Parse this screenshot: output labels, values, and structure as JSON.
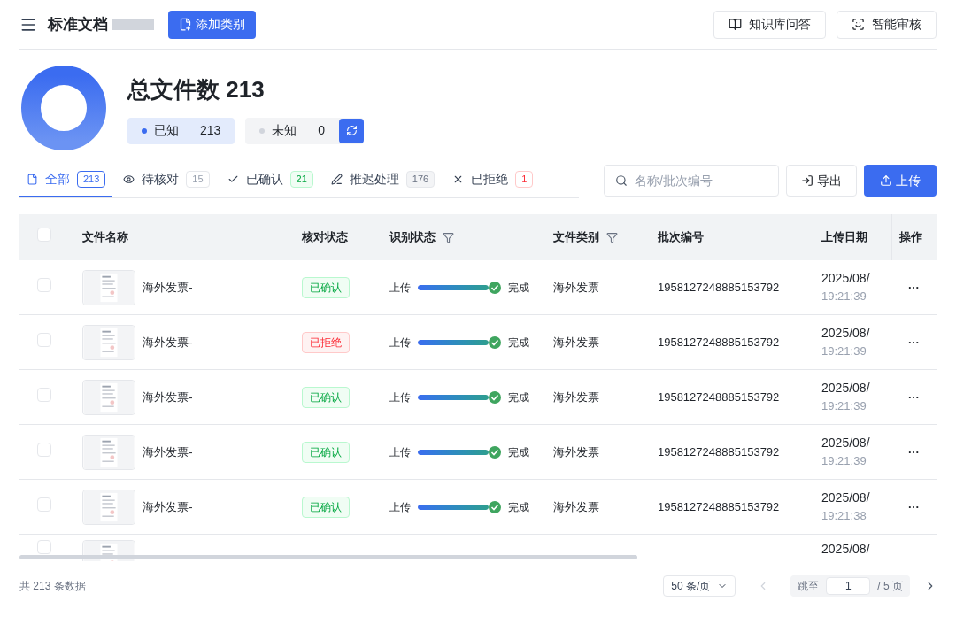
{
  "header": {
    "title": "标准文档",
    "add_button": "添加类别",
    "actions": [
      {
        "label": "知识库问答",
        "kind": "book"
      },
      {
        "label": "智能审核",
        "kind": "scan"
      }
    ]
  },
  "summary": {
    "title": "总文件数 213",
    "known": {
      "label": "已知",
      "count": "213"
    },
    "unknown": {
      "label": "未知",
      "count": "0"
    }
  },
  "tabs": [
    {
      "label": "全部",
      "count": "213",
      "kind": "all",
      "selected": true
    },
    {
      "label": "待核对",
      "count": "15",
      "kind": "pending",
      "selected": false
    },
    {
      "label": "已确认",
      "count": "21",
      "kind": "confirmed",
      "selected": false
    },
    {
      "label": "推迟处理",
      "count": "176",
      "kind": "deferred",
      "selected": false
    },
    {
      "label": "已拒绝",
      "count": "1",
      "kind": "rejected",
      "selected": false
    }
  ],
  "search": {
    "placeholder": "名称/批次编号"
  },
  "export_button": "导出",
  "upload_button": "上传",
  "table": {
    "header_checked": false,
    "columns": [
      "文件名称",
      "核对状态",
      "识别状态",
      "文件类别",
      "批次编号",
      "上传日期",
      "操作"
    ],
    "rows": [
      {
        "checked": false,
        "name": "海外发票-",
        "status": {
          "label": "已确认",
          "kind": "confirmed"
        },
        "recog_start": "上传",
        "level": 1,
        "recog_end": "完成",
        "category": "海外发票",
        "batch": "1958127248885153792",
        "date": "2025/08/",
        "time": "19:21:39",
        "more": "···"
      },
      {
        "checked": false,
        "name": "海外发票-",
        "status": {
          "label": "已拒绝",
          "kind": "rejected"
        },
        "recog_start": "上传",
        "level": 1,
        "recog_end": "完成",
        "category": "海外发票",
        "batch": "1958127248885153792",
        "date": "2025/08/",
        "time": "19:21:39",
        "more": "···"
      },
      {
        "checked": false,
        "name": "海外发票-",
        "status": {
          "label": "已确认",
          "kind": "confirmed"
        },
        "recog_start": "上传",
        "level": 1,
        "recog_end": "完成",
        "category": "海外发票",
        "batch": "1958127248885153792",
        "date": "2025/08/",
        "time": "19:21:39",
        "more": "···"
      },
      {
        "checked": false,
        "name": "海外发票-",
        "status": {
          "label": "已确认",
          "kind": "confirmed"
        },
        "recog_start": "上传",
        "level": 1,
        "recog_end": "完成",
        "category": "海外发票",
        "batch": "1958127248885153792",
        "date": "2025/08/",
        "time": "19:21:39",
        "more": "···"
      },
      {
        "checked": false,
        "name": "海外发票-",
        "status": {
          "label": "已确认",
          "kind": "confirmed"
        },
        "recog_start": "上传",
        "level": 1,
        "recog_end": "完成",
        "category": "海外发票",
        "batch": "1958127248885153792",
        "date": "2025/08/",
        "time": "19:21:38",
        "more": "···"
      },
      {
        "checked": false,
        "date": "2025/08/"
      }
    ]
  },
  "footer": {
    "total": "共 213 条数据",
    "page_size": "50 条/页",
    "jump_label": "跳至",
    "page": "1",
    "pages": "/ 5 页"
  }
}
